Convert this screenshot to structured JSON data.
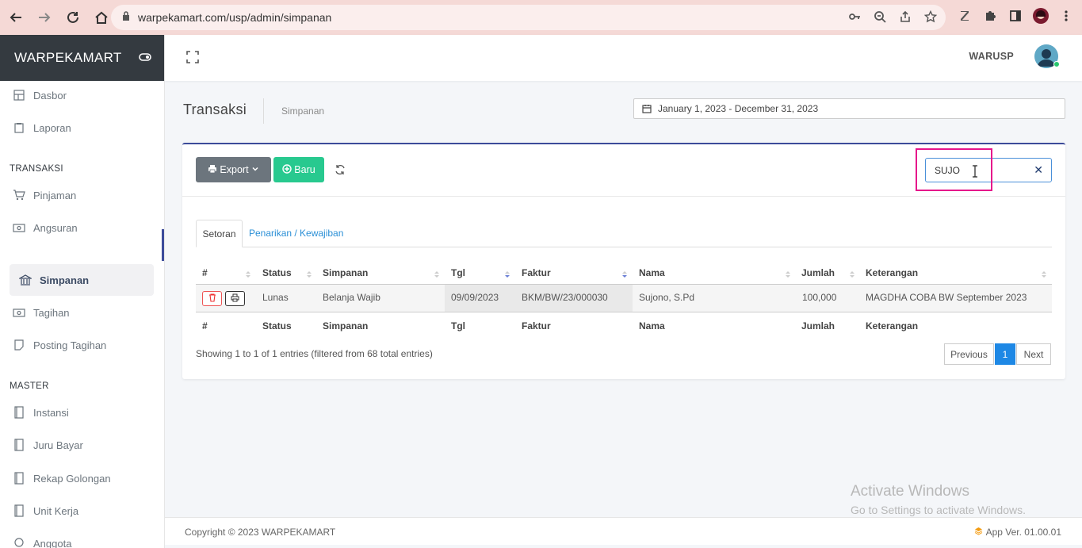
{
  "browser": {
    "url": "warpekamart.com/usp/admin/simpanan"
  },
  "sidebar": {
    "brand": "WARPEKAMART",
    "items": [
      {
        "label": "Dasbor",
        "icon": "dashboard-icon"
      },
      {
        "label": "Laporan",
        "icon": "report-icon"
      }
    ],
    "section_transaksi": "TRANSAKSI",
    "transaksi_items": [
      {
        "label": "Pinjaman",
        "icon": "cart-icon"
      },
      {
        "label": "Angsuran",
        "icon": "money-icon"
      },
      {
        "label": "Simpanan",
        "icon": "bank-icon"
      },
      {
        "label": "Tagihan",
        "icon": "money-icon"
      },
      {
        "label": "Posting Tagihan",
        "icon": "note-icon"
      }
    ],
    "section_master": "MASTER",
    "master_items": [
      {
        "label": "Instansi",
        "icon": "book-icon"
      },
      {
        "label": "Juru Bayar",
        "icon": "book-icon"
      },
      {
        "label": "Rekap Golongan",
        "icon": "book-icon"
      },
      {
        "label": "Unit Kerja",
        "icon": "book-icon"
      },
      {
        "label": "Anggota",
        "icon": "user-icon"
      }
    ]
  },
  "topbar": {
    "user_name": "WARUSP"
  },
  "page": {
    "title": "Transaksi",
    "breadcrumb": "Simpanan",
    "date_range": "January 1, 2023 - December 31, 2023"
  },
  "toolbar": {
    "export_label": "Export",
    "new_label": "Baru",
    "search_value": "SUJO"
  },
  "tabs": {
    "active": "Setoran",
    "other": "Penarikan / Kewajiban"
  },
  "table": {
    "headers": [
      "#",
      "Status",
      "Simpanan",
      "Tgl",
      "Faktur",
      "Nama",
      "Jumlah",
      "Keterangan"
    ],
    "rows": [
      {
        "status": "Lunas",
        "simpanan": "Belanja Wajib",
        "tgl": "09/09/2023",
        "faktur": "BKM/BW/23/000030",
        "nama": "Sujono, S.Pd",
        "jumlah": "100,000",
        "keterangan": "MAGDHA COBA BW September 2023"
      }
    ],
    "info": "Showing 1 to 1 of 1 entries (filtered from 68 total entries)",
    "pagination": {
      "previous": "Previous",
      "current": "1",
      "next": "Next"
    }
  },
  "watermark": {
    "title": "Activate Windows",
    "subtitle": "Go to Settings to activate Windows."
  },
  "footer": {
    "copyright": "Copyright © 2023 WARPEKAMART",
    "version": "App Ver. 01.00.01"
  },
  "colors": {
    "brand_bg": "#343a40",
    "export_btn": "#6c757d",
    "new_btn": "#28c98f",
    "accent": "#3c4b9a",
    "pager_active": "#1e88e5",
    "highlight": "#e6158b"
  }
}
